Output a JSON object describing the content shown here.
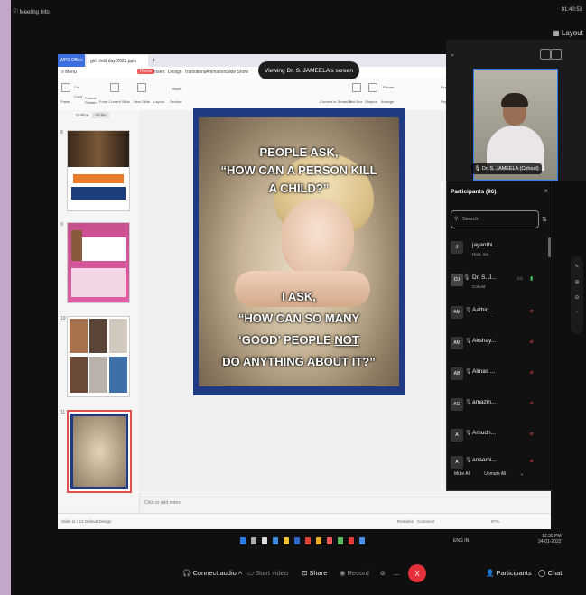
{
  "top": {
    "meeting_info": "Meeting Info",
    "clock": "01:40:53",
    "layout_label": "Layout"
  },
  "banner": {
    "viewing": "Viewing Dr. S. JAMEELA's screen"
  },
  "office": {
    "tab_office": "WPS Office",
    "tab_file": "girl child day 2022.pptx",
    "tab_plus": "+",
    "menu": [
      "≡ Menu",
      "Home",
      "Insert",
      "Design",
      "Transitions",
      "Animation",
      "Slide Show"
    ],
    "ribbon_labels": [
      "Paste",
      "Cut",
      "Copy",
      "Format Painter",
      "From Current Slide",
      "New Slide",
      "Layout",
      "Section",
      "Reset",
      "Convert to SmartArt",
      "Text Box",
      "Shapes",
      "Picture",
      "Arrange",
      "Find",
      "Replace"
    ],
    "panel_tabs": [
      "Outline",
      "Slides"
    ],
    "slide_numbers": [
      "8",
      "9",
      "10",
      "11"
    ],
    "add_slide": "+",
    "notes_placeholder": "Click to add notes",
    "status_left": "Slide 11 / 12",
    "status_design": "Default Design",
    "status_right": [
      "Remarks",
      "Comment",
      "87%"
    ]
  },
  "slide": {
    "line1": "PEOPLE ASK,",
    "line2": "“HOW CAN A PERSON KILL",
    "line3": "A CHILD?”",
    "line4": "I ASK,",
    "line5": "“HOW CAN SO MANY",
    "line6a": "‘GOOD’ PEOPLE ",
    "line6b": "NOT",
    "line7": "DO ANYTHING ABOUT IT?”"
  },
  "video": {
    "name": "Dr. S. JAMEELA (Cohost)"
  },
  "participants": {
    "title": "Participants (96)",
    "search_placeholder": "Search",
    "list": [
      {
        "initials": "J",
        "name": "jayanthi...",
        "sub": "Host, me"
      },
      {
        "initials": "DJ",
        "name": "Dr. S. J...",
        "sub": "Cohost"
      },
      {
        "initials": "AM",
        "name": "Aathiq...",
        "sub": ""
      },
      {
        "initials": "AM",
        "name": "Akshay...",
        "sub": ""
      },
      {
        "initials": "AB",
        "name": "Almas ...",
        "sub": ""
      },
      {
        "initials": "AG",
        "name": "amazin...",
        "sub": ""
      },
      {
        "initials": "A",
        "name": "Amudh...",
        "sub": ""
      },
      {
        "initials": "A",
        "name": "anaami...",
        "sub": ""
      }
    ],
    "mute_all": "Mute All",
    "unmute_all": "Unmute All"
  },
  "taskbar": {
    "tray_text": "ENG IN",
    "time": "12:30 PM",
    "date": "24-01-2022"
  },
  "controls": {
    "connect_audio": "Connect audio",
    "start_video": "Start video",
    "share": "Share",
    "record": "Record",
    "more": "...",
    "leave": "X",
    "participants": "Participants",
    "chat": "Chat"
  }
}
